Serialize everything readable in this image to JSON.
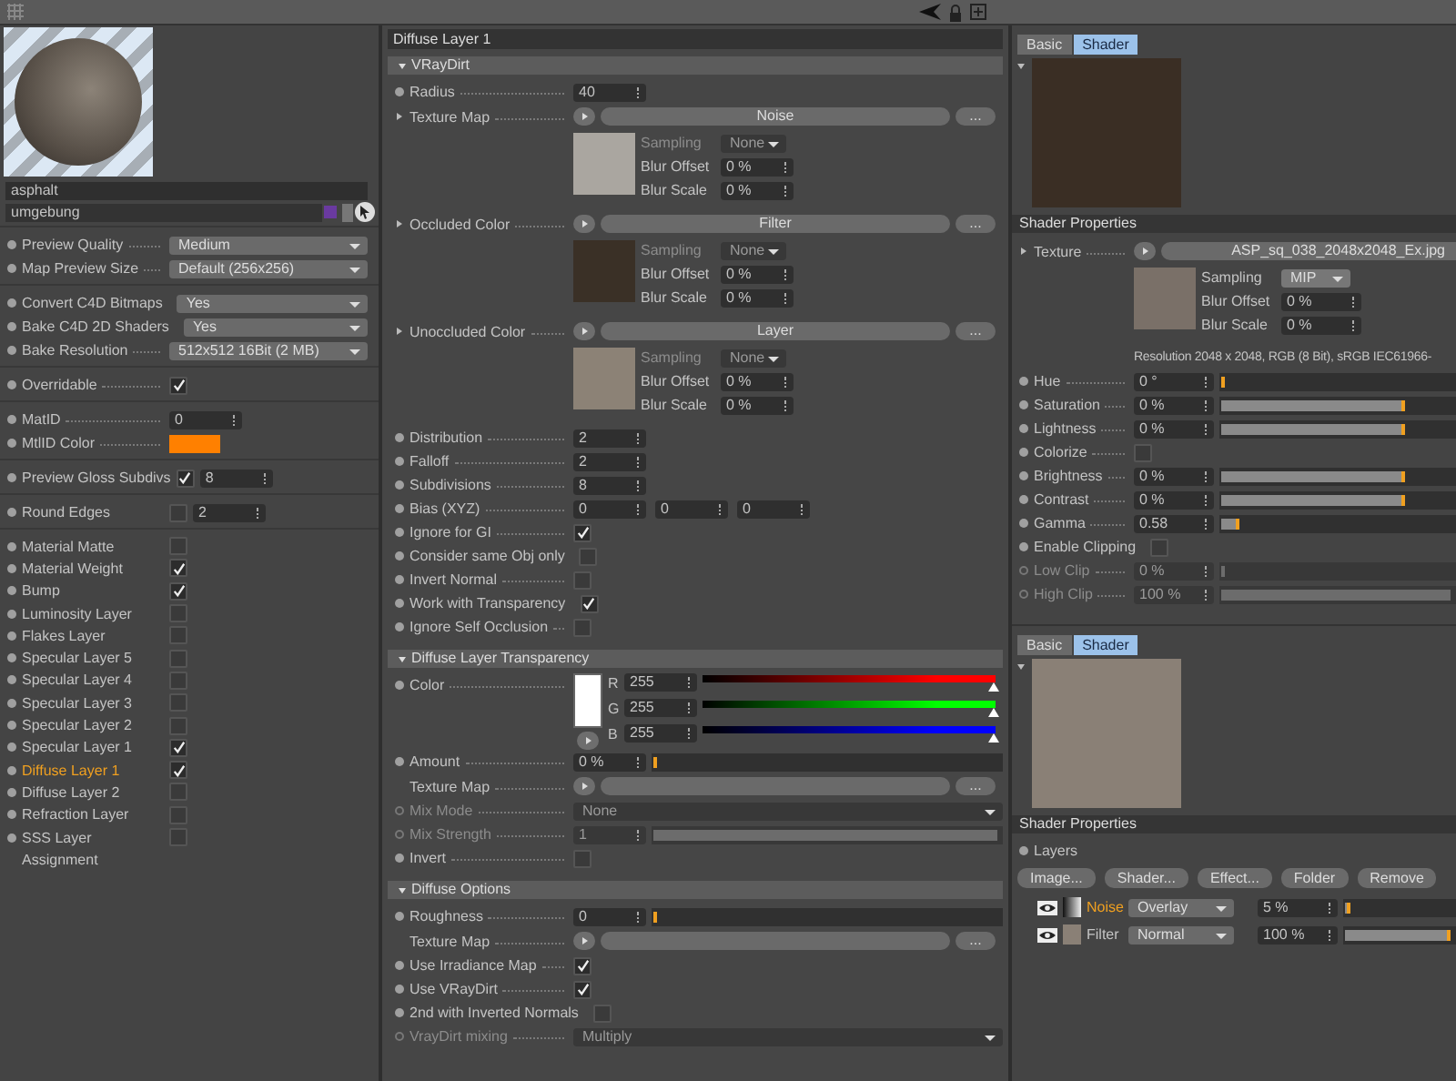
{
  "left": {
    "name": "asphalt",
    "tag": "umgebung",
    "groups": [
      [
        {
          "kind": "dropdown",
          "label": "Preview Quality",
          "value": "Medium"
        },
        {
          "kind": "dropdown",
          "label": "Map Preview Size",
          "value": "Default (256x256)"
        }
      ],
      [
        {
          "kind": "dropdown",
          "label": "Convert C4D Bitmaps",
          "value": "Yes"
        },
        {
          "kind": "dropdown",
          "label": "Bake C4D 2D Shaders",
          "value": "Yes"
        },
        {
          "kind": "dropdown",
          "label": "Bake Resolution",
          "value": "512x512 16Bit (2 MB)"
        }
      ],
      [
        {
          "kind": "check",
          "label": "Overridable",
          "checked": true
        }
      ],
      [
        {
          "kind": "spin",
          "label": "MatID",
          "value": "0"
        },
        {
          "kind": "swatch",
          "label": "MtlID Color",
          "color": "#ff8000"
        }
      ],
      [
        {
          "kind": "check_spin",
          "label": "Preview Gloss Subdivs",
          "checked": true,
          "value": "8"
        }
      ],
      [
        {
          "kind": "check_spin",
          "label": "Round Edges",
          "checked": false,
          "value": "2"
        }
      ]
    ],
    "channels": [
      {
        "label": "Material Matte",
        "checked": false,
        "selected": false
      },
      {
        "label": "Material Weight",
        "checked": true,
        "selected": false
      },
      {
        "label": "Bump",
        "checked": true,
        "selected": false
      },
      {
        "label": "Luminosity Layer",
        "checked": false,
        "selected": false
      },
      {
        "label": "Flakes Layer",
        "checked": false,
        "selected": false
      },
      {
        "label": "Specular Layer 5",
        "checked": false,
        "selected": false
      },
      {
        "label": "Specular Layer 4",
        "checked": false,
        "selected": false
      },
      {
        "label": "Specular Layer 3",
        "checked": false,
        "selected": false
      },
      {
        "label": "Specular Layer 2",
        "checked": false,
        "selected": false
      },
      {
        "label": "Specular Layer 1",
        "checked": true,
        "selected": false
      },
      {
        "label": "Diffuse Layer 1",
        "checked": true,
        "selected": true
      },
      {
        "label": "Diffuse Layer 2",
        "checked": false,
        "selected": false
      },
      {
        "label": "Refraction Layer",
        "checked": false,
        "selected": false
      },
      {
        "label": "SSS Layer",
        "checked": false,
        "selected": false
      }
    ],
    "assignment": "Assignment"
  },
  "middle": {
    "title": "Diffuse Layer 1",
    "sections": [
      {
        "title": "VRayDirt",
        "expanded": true,
        "rows": [
          {
            "kind": "spin",
            "label": "Radius",
            "value": "40"
          },
          {
            "kind": "shader",
            "label": "Texture Map",
            "value": "Noise",
            "more": "...",
            "color": "#aaa6a0",
            "sub": [
              {
                "kind": "dropdown",
                "label": "Sampling",
                "value": "None",
                "disabled": true
              },
              {
                "kind": "spin",
                "label": "Blur Offset",
                "value": "0 %"
              },
              {
                "kind": "spin",
                "label": "Blur Scale",
                "value": "0 %"
              }
            ]
          },
          {
            "kind": "shader",
            "label": "Occluded Color",
            "value": "Filter",
            "more": "...",
            "color": "#3a3026",
            "sub": [
              {
                "kind": "dropdown",
                "label": "Sampling",
                "value": "None",
                "disabled": true
              },
              {
                "kind": "spin",
                "label": "Blur Offset",
                "value": "0 %"
              },
              {
                "kind": "spin",
                "label": "Blur Scale",
                "value": "0 %"
              }
            ]
          },
          {
            "kind": "shader",
            "label": "Unoccluded Color",
            "value": "Layer",
            "more": "...",
            "color": "#8c8276",
            "sub": [
              {
                "kind": "dropdown",
                "label": "Sampling",
                "value": "None",
                "disabled": true
              },
              {
                "kind": "spin",
                "label": "Blur Offset",
                "value": "0 %"
              },
              {
                "kind": "spin",
                "label": "Blur Scale",
                "value": "0 %"
              }
            ]
          },
          {
            "kind": "spin",
            "label": "Distribution",
            "value": "2"
          },
          {
            "kind": "spin",
            "label": "Falloff",
            "value": "2"
          },
          {
            "kind": "spin",
            "label": "Subdivisions",
            "value": "8"
          },
          {
            "kind": "spin3",
            "label": "Bias (XYZ)",
            "values": [
              "0",
              "0",
              "0"
            ]
          },
          {
            "kind": "check",
            "label": "Ignore for GI",
            "checked": true
          },
          {
            "kind": "check",
            "label": "Consider same Obj only",
            "checked": false
          },
          {
            "kind": "check",
            "label": "Invert Normal",
            "checked": false
          },
          {
            "kind": "check",
            "label": "Work with Transparency",
            "checked": true
          },
          {
            "kind": "check",
            "label": "Ignore Self Occlusion",
            "checked": false
          }
        ]
      },
      {
        "title": "Diffuse Layer Transparency",
        "expanded": true,
        "rows": [
          {
            "kind": "rgb",
            "label": "Color",
            "color": "#ffffff",
            "channels": [
              {
                "label": "R",
                "value": "255",
                "color": "#ff0000",
                "level": 1
              },
              {
                "label": "G",
                "value": "255",
                "color": "#00ff00",
                "level": 1
              },
              {
                "label": "B",
                "value": "255",
                "color": "#0000ff",
                "level": 1
              }
            ]
          },
          {
            "kind": "slider",
            "label": "Amount",
            "value": "0 %",
            "level": 0
          },
          {
            "kind": "shader",
            "label": "Texture Map",
            "more": "..."
          },
          {
            "kind": "dropdown",
            "label": "Mix Mode",
            "value": "None",
            "disabled": true
          },
          {
            "kind": "slider",
            "label": "Mix Strength",
            "value": "1",
            "level": 1,
            "disabled": true
          },
          {
            "kind": "check",
            "label": "Invert",
            "checked": false
          }
        ]
      },
      {
        "title": "Diffuse Options",
        "expanded": true,
        "rows": [
          {
            "kind": "slider",
            "label": "Roughness",
            "value": "0",
            "level": 0
          },
          {
            "kind": "shader",
            "label": "Texture Map",
            "more": "..."
          },
          {
            "kind": "check",
            "label": "Use Irradiance Map",
            "checked": true
          },
          {
            "kind": "check",
            "label": "Use VRayDirt",
            "checked": true
          },
          {
            "kind": "check",
            "label": "2nd with Inverted Normals",
            "checked": false
          },
          {
            "kind": "dropdown",
            "label": "VrayDirt mixing",
            "value": "Multiply",
            "disabled": true
          }
        ]
      }
    ]
  },
  "right": {
    "panes": [
      {
        "tabs": [
          {
            "label": "Basic",
            "selected": false
          },
          {
            "label": "Shader",
            "selected": true
          }
        ],
        "color": "#3a2e24",
        "header": "Shader Properties",
        "rows": [
          {
            "kind": "shader",
            "label": "Texture",
            "value": "ASP_sq_038_2048x2048_Ex.jpg",
            "color": "#7a7068",
            "sub": [
              {
                "kind": "dropdown",
                "label": "Sampling",
                "value": "MIP"
              },
              {
                "kind": "spin",
                "label": "Blur Offset",
                "value": "0 %"
              },
              {
                "kind": "spin",
                "label": "Blur Scale",
                "value": "0 %"
              }
            ]
          },
          {
            "kind": "text",
            "text": "Resolution 2048 x 2048, RGB (8 Bit), sRGB IEC61966-"
          },
          {
            "kind": "slider",
            "label": "Hue",
            "value": "0 °",
            "level": 0
          },
          {
            "kind": "slider",
            "label": "Saturation",
            "value": "0 %",
            "level": 0.8
          },
          {
            "kind": "slider",
            "label": "Lightness",
            "value": "0 %",
            "level": 0.8
          },
          {
            "kind": "check",
            "label": "Colorize",
            "checked": false
          },
          {
            "kind": "slider",
            "label": "Brightness",
            "value": "0 %",
            "level": 0.8
          },
          {
            "kind": "slider",
            "label": "Contrast",
            "value": "0 %",
            "level": 0.8
          },
          {
            "kind": "slider",
            "label": "Gamma",
            "value": "0.58",
            "level": 0.08
          },
          {
            "kind": "check",
            "label": "Enable Clipping",
            "checked": false
          },
          {
            "kind": "slider",
            "label": "Low Clip",
            "value": "0 %",
            "level": 0,
            "disabled": true
          },
          {
            "kind": "slider",
            "label": "High Clip",
            "value": "100 %",
            "level": 1,
            "disabled": true
          }
        ]
      },
      {
        "tabs": [
          {
            "label": "Basic",
            "selected": false
          },
          {
            "label": "Shader",
            "selected": true
          }
        ],
        "color": "#8a8076",
        "header": "Shader Properties",
        "rows": [
          {
            "kind": "label",
            "label": "Layers"
          }
        ],
        "buttons": [
          "Image...",
          "Shader...",
          "Effect...",
          "Folder",
          "Remove"
        ],
        "layers": [
          {
            "kind": "noise",
            "name": "Noise",
            "selected": true,
            "mode": "Overlay",
            "value": "5 %",
            "level": 0.05
          },
          {
            "kind": "filter",
            "name": "Filter",
            "selected": false,
            "mode": "Normal",
            "value": "100 %",
            "level": 1
          }
        ]
      }
    ]
  }
}
